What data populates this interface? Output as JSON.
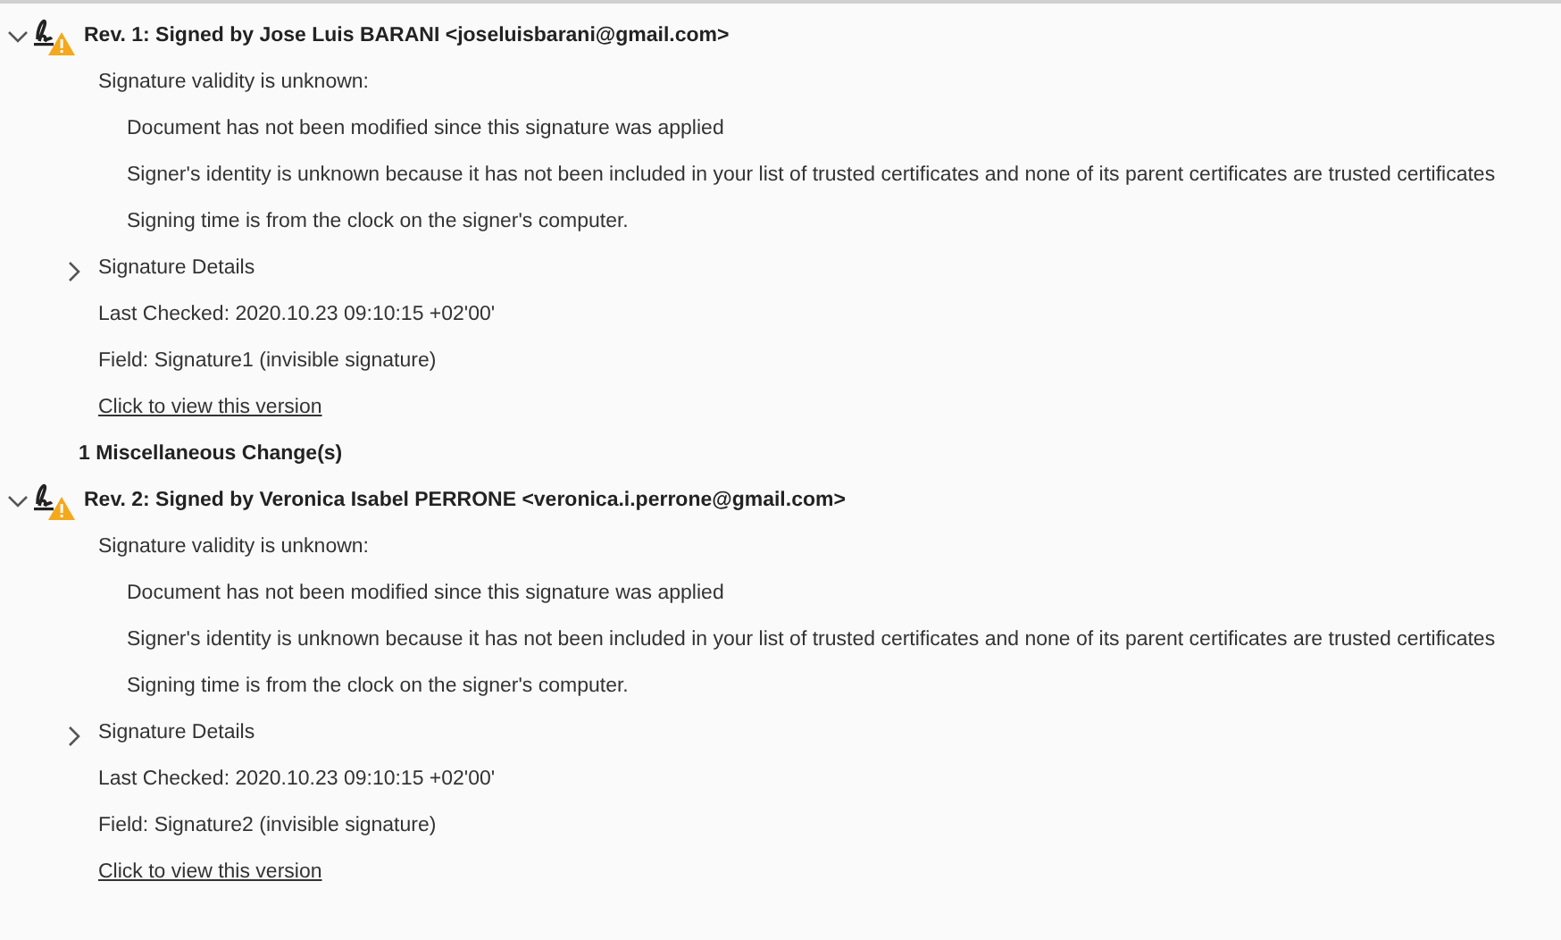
{
  "entries": [
    {
      "kind": "revision",
      "expanded": true,
      "title": "Rev. 1: Signed by Jose Luis BARANI <joseluisbarani@gmail.com>",
      "validity": "Signature validity is unknown:",
      "notes": [
        "Document has not been modified since this signature was applied",
        "Signer's identity is unknown because it has not been included in your list of trusted certificates and none of its parent certificates are trusted certificates",
        "Signing time is from the clock on the signer's computer."
      ],
      "details": {
        "label": "Signature Details",
        "expanded": false
      },
      "last_checked": "Last Checked: 2020.10.23 09:10:15 +02'00'",
      "field": "Field: Signature1 (invisible signature)",
      "link": "Click to view this version"
    },
    {
      "kind": "change",
      "label": "1 Miscellaneous Change(s)"
    },
    {
      "kind": "revision",
      "expanded": true,
      "title": "Rev. 2: Signed by Veronica Isabel PERRONE <veronica.i.perrone@gmail.com>",
      "validity": "Signature validity is unknown:",
      "notes": [
        "Document has not been modified since this signature was applied",
        "Signer's identity is unknown because it has not been included in your list of trusted certificates and none of its parent certificates are trusted certificates",
        "Signing time is from the clock on the signer's computer."
      ],
      "details": {
        "label": "Signature Details",
        "expanded": false
      },
      "last_checked": "Last Checked: 2020.10.23 09:10:15 +02'00'",
      "field": "Field: Signature2 (invisible signature)",
      "link": "Click to view this version"
    }
  ]
}
